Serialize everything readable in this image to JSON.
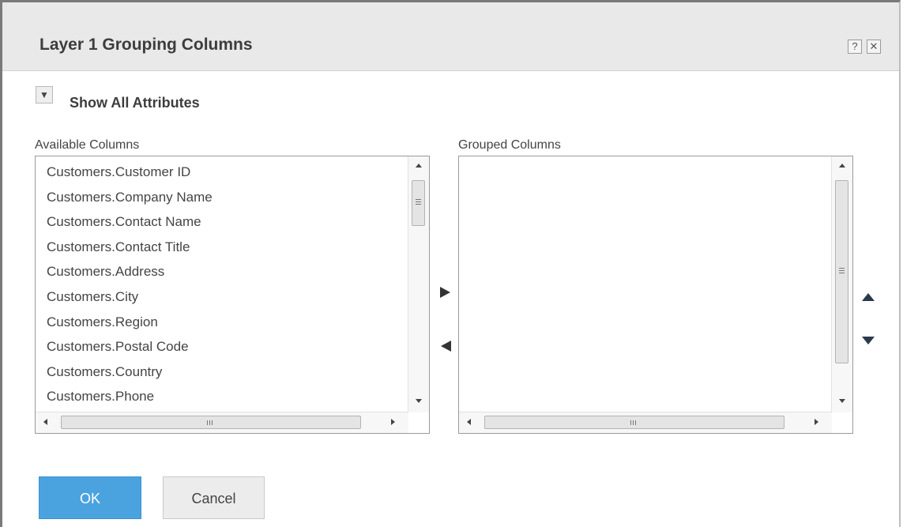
{
  "dialog": {
    "title": "Layer 1 Grouping Columns",
    "help_label": "?",
    "close_label": "✕"
  },
  "attributes_toggle": {
    "icon_glyph": "▼",
    "label": "Show All Attributes"
  },
  "available": {
    "label": "Available Columns",
    "items": [
      "Customers.Customer ID",
      "Customers.Company Name",
      "Customers.Contact Name",
      "Customers.Contact Title",
      "Customers.Address",
      "Customers.City",
      "Customers.Region",
      "Customers.Postal Code",
      "Customers.Country",
      "Customers.Phone"
    ]
  },
  "grouped": {
    "label": "Grouped Columns",
    "items": []
  },
  "buttons": {
    "ok": "OK",
    "cancel": "Cancel"
  },
  "colors": {
    "primary": "#4aa3df",
    "titlebar": "#e9e9e9"
  }
}
